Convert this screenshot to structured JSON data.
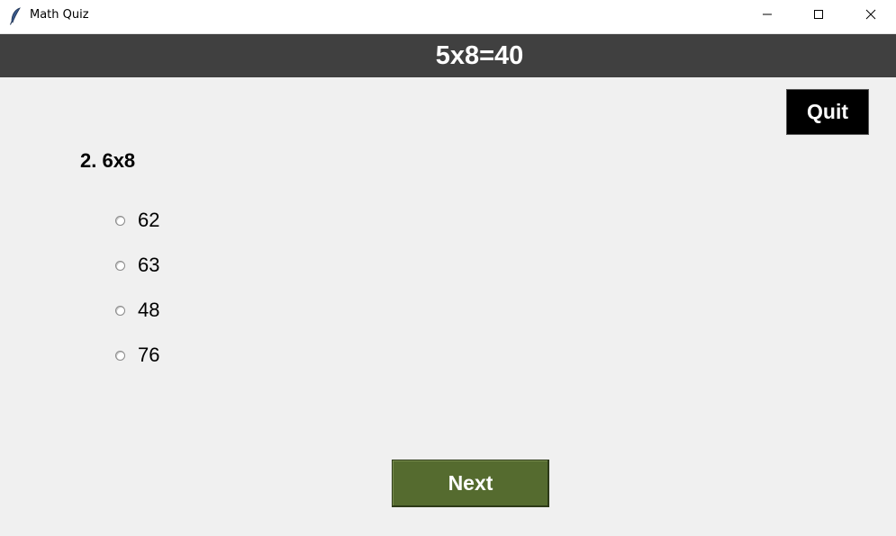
{
  "window": {
    "title": "Math Quiz",
    "app_icon": "feather-icon",
    "controls": {
      "minimize": "minimize-icon",
      "maximize": "maximize-icon",
      "close": "close-icon"
    }
  },
  "header": {
    "text": "5x8=40",
    "background": "#404040"
  },
  "quit_button": {
    "label": "Quit",
    "background": "#000000"
  },
  "question": {
    "text": "2. 6x8"
  },
  "options": [
    {
      "label": "62",
      "selected": false
    },
    {
      "label": "63",
      "selected": false
    },
    {
      "label": "48",
      "selected": false
    },
    {
      "label": "76",
      "selected": false
    }
  ],
  "next_button": {
    "label": "Next",
    "background": "#556b2f"
  }
}
